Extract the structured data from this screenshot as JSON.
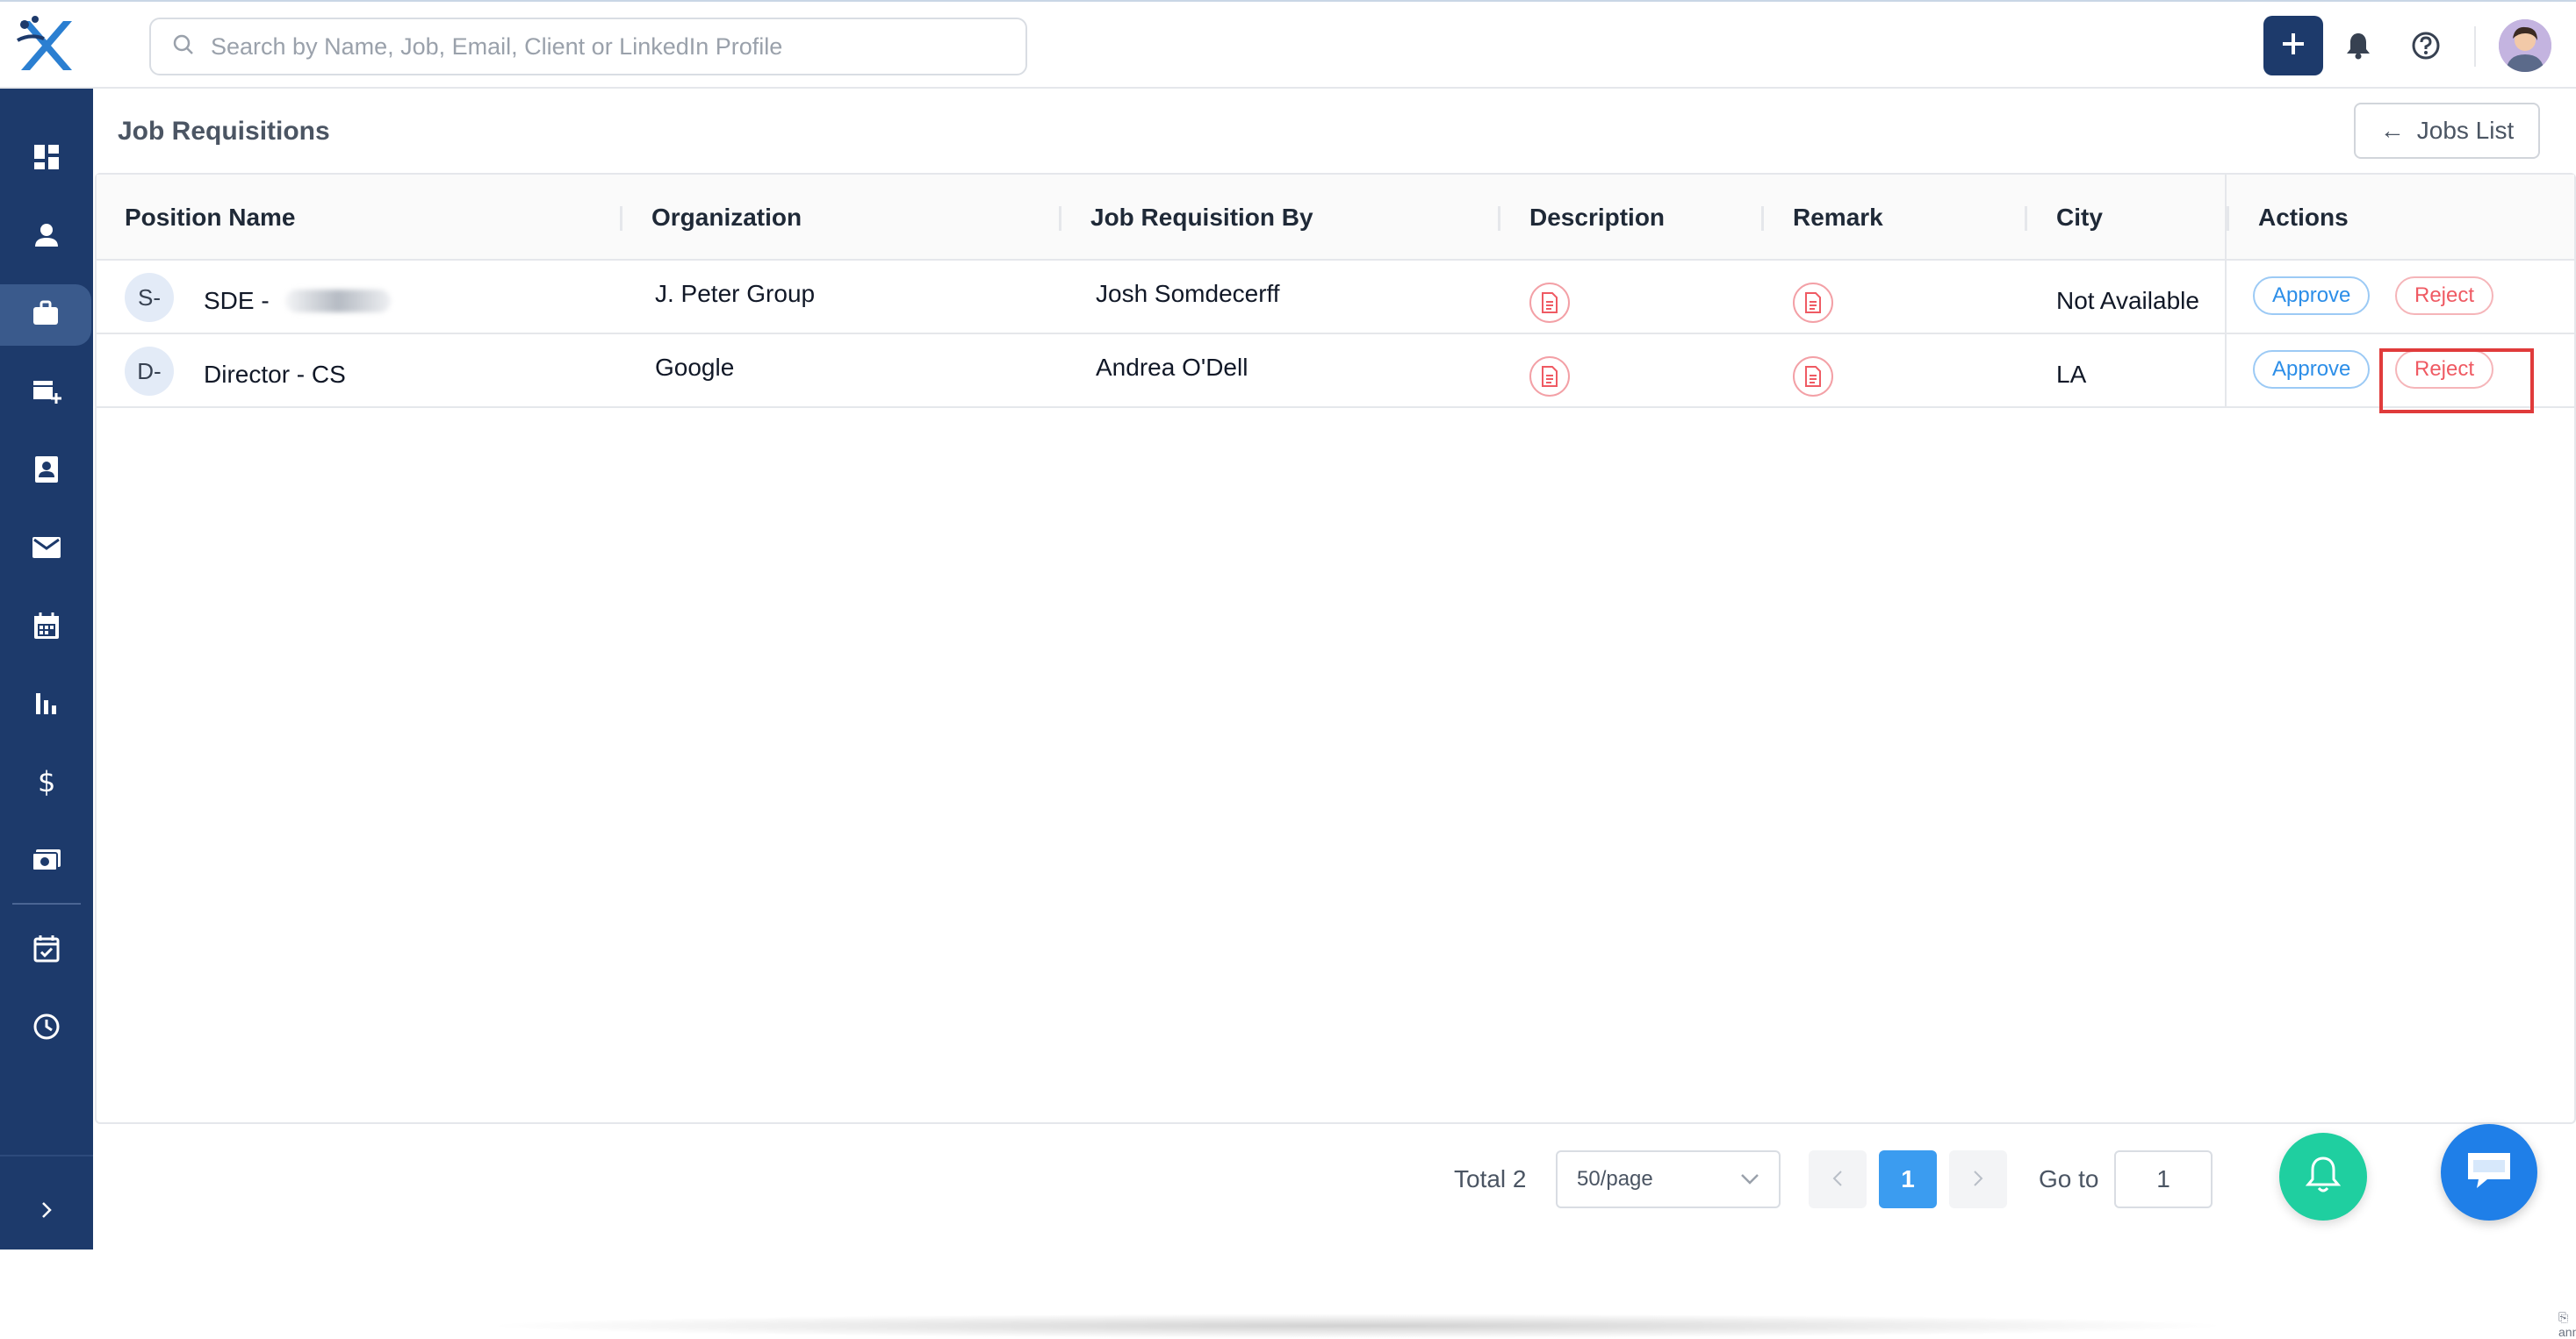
{
  "header": {
    "search_placeholder": "Search by Name, Job, Email, Client or LinkedIn Profile"
  },
  "page": {
    "title": "Job Requisitions",
    "jobs_list_label": "Jobs List"
  },
  "table": {
    "columns": [
      "Position Name",
      "Organization",
      "Job Requisition By",
      "Description",
      "Remark",
      "City",
      "Actions"
    ],
    "rows": [
      {
        "initial": "S-",
        "position": "SDE -",
        "organization": "J. Peter Group",
        "requested_by": "Josh Somdecerff",
        "city": "Not Available",
        "approve": "Approve",
        "reject": "Reject"
      },
      {
        "initial": "D-",
        "position": "Director - CS",
        "organization": "Google",
        "requested_by": "Andrea O'Dell",
        "city": "LA",
        "approve": "Approve",
        "reject": "Reject"
      }
    ]
  },
  "pagination": {
    "total": "Total 2",
    "page_size": "50/page",
    "current_page": "1",
    "goto_label": "Go to",
    "goto_value": "1"
  },
  "watermark": "annotely.com",
  "colors": {
    "sidebar": "#1d3a6b",
    "accent": "#3b9cf0",
    "approve": "#2c8ee8",
    "reject": "#ef5a63",
    "highlight": "#e03b3b"
  }
}
